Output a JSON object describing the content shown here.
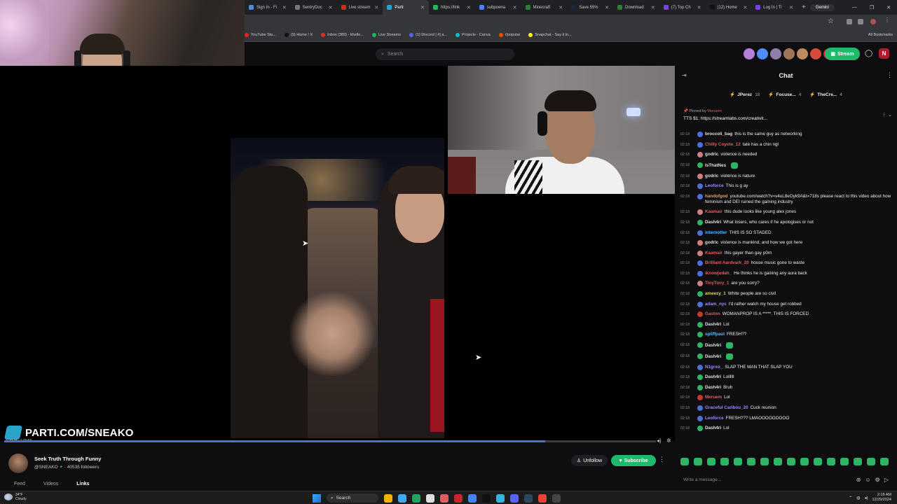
{
  "browser": {
    "tabs": [
      {
        "label": "Sign In - Fi",
        "color": "#4a90d9"
      },
      {
        "label": "SentryDoc",
        "color": "#777"
      },
      {
        "label": "Live stream",
        "color": "#e62117"
      },
      {
        "label": "Parti",
        "color": "#2aa3c9",
        "active": true
      },
      {
        "label": "https://link",
        "color": "#1db954"
      },
      {
        "label": "subpoena",
        "color": "#4285f4"
      },
      {
        "label": "Minecraft",
        "color": "#2e7d32"
      },
      {
        "label": "Save 55%",
        "color": "#1b2838"
      },
      {
        "label": "Download",
        "color": "#2e7d32"
      },
      {
        "label": "(7) Top Ch",
        "color": "#7b3fe4"
      },
      {
        "label": "(12) Home",
        "color": "#111"
      },
      {
        "label": "Log In | Ti",
        "color": "#7b3fe4"
      }
    ],
    "new_tab": "+",
    "gemini_label": "Gemini",
    "window_controls": [
      "—",
      "❐",
      "✕"
    ],
    "bookmarks": [
      {
        "label": "YouTube Stu...",
        "color": "#e62117"
      },
      {
        "label": "(9) Home / X",
        "color": "#111"
      },
      {
        "label": "Inbox (389) - khelle...",
        "color": "#d93025"
      },
      {
        "label": "Live Streams",
        "color": "#1db954"
      },
      {
        "label": "(1) Discord | #| a...",
        "color": "#5865f2"
      },
      {
        "label": "Projects - Canva",
        "color": "#00c4cc"
      },
      {
        "label": "r/popular",
        "color": "#ff4500"
      },
      {
        "label": "Snapchat - Say it in...",
        "color": "#fffc00"
      }
    ],
    "all_bookmarks": "All Bookmarks"
  },
  "site": {
    "search_placeholder": "Search",
    "stream_button": "Stream",
    "me_initial": "N",
    "avatar_colors": [
      "#b57edc",
      "#4f8ef7",
      "#8e7fa8",
      "#a0765a",
      "#c08860",
      "#d44b3b",
      "#d6213a"
    ]
  },
  "video": {
    "brand_text": "PARTI.COM/SNEAKO",
    "timestamp": "1:20:18 / 1:20:56",
    "progress_fraction": 0.83
  },
  "channel": {
    "title": "Seek Truth Through Funny",
    "handle": "@SNEAKO",
    "followers": "40535 followers",
    "unfollow": "Unfollow",
    "subscribe": "Subscribe",
    "tabs": [
      "Feed",
      "Videos",
      "Links"
    ],
    "active_tab": "Links"
  },
  "chat": {
    "title": "Chat",
    "leaders": [
      {
        "name": "JPerez",
        "count": "18"
      },
      {
        "name": "Focuse...",
        "count": "4"
      },
      {
        "name": "TheCre...",
        "count": "4"
      }
    ],
    "pinned_by": "Pinned by",
    "pinned_user": "Meruem",
    "pinned_message": "TTS $1: https://streamlabs.com/creativit...",
    "messages": [
      {
        "time": "02:18",
        "user": "broccoli_bag",
        "color": "#e0e0e0",
        "text": "this is the same guy as networking",
        "badge": "#4f6fd8"
      },
      {
        "time": "02:18",
        "user": "Chilly Coyote_12",
        "color": "#e05d5d",
        "text": "tate has a chin ngl",
        "badge": "#4f6fd8"
      },
      {
        "time": "02:18",
        "user": "godric",
        "color": "#e0e0e0",
        "text": "violence is needed",
        "badge": "#d07f7f"
      },
      {
        "time": "02:18",
        "user": "IsThatNes",
        "color": "#e0e0e0",
        "text": "",
        "emote": true,
        "badge": "#2fb463"
      },
      {
        "time": "02:18",
        "user": "godric",
        "color": "#e0e0e0",
        "text": "violence is nature",
        "badge": "#d07f7f"
      },
      {
        "time": "02:18",
        "user": "Leoforce",
        "color": "#9c8cff",
        "text": "This is g ay",
        "badge": "#4f6fd8"
      },
      {
        "time": "02:18",
        "user": "handofgod",
        "color": "#e0a060",
        "text": "youtube.com/watch?v=v4uL8eOyk9A&t=718s please react to this video about how feminism and DEI ruined the gaming industry",
        "badge": "#4f6fd8"
      },
      {
        "time": "02:18",
        "user": "Kaamair",
        "color": "#e05d5d",
        "text": "this dude looks like young alex jones",
        "badge": "#d07f7f"
      },
      {
        "time": "02:18",
        "user": "Dash4ri",
        "color": "#e0e0e0",
        "text": "What losers, who cares if he apologises or not",
        "badge": "#2fb463"
      },
      {
        "time": "02:18",
        "user": "internotter",
        "color": "#5db8ff",
        "text": "THIS IS SO STAGED",
        "badge": "#4f6fd8"
      },
      {
        "time": "02:18",
        "user": "godric",
        "color": "#e0e0e0",
        "text": "violence is mankind, and how we got here",
        "badge": "#d07f7f"
      },
      {
        "time": "02:18",
        "user": "Kaamair",
        "color": "#e05d5d",
        "text": "this gayer than gay p0rn",
        "badge": "#d07f7f"
      },
      {
        "time": "02:18",
        "user": "Brilliant Aardvark_20",
        "color": "#e05d5d",
        "text": "house music gone to waste",
        "badge": "#4f6fd8"
      },
      {
        "time": "02:18",
        "user": "iknowjudah_",
        "color": "#e05d5d",
        "text": "He thinks he is gaining any aura back",
        "badge": "#4f6fd8"
      },
      {
        "time": "02:18",
        "user": "TinyTony_1",
        "color": "#e05d5d",
        "text": "are you sorry?",
        "badge": "#d07f7f"
      },
      {
        "time": "02:18",
        "user": "ameezy_1",
        "color": "#e0d060",
        "text": "White people are so civil",
        "badge": "#2fb463"
      },
      {
        "time": "02:18",
        "user": "adam_nyc",
        "color": "#9c8cff",
        "text": "I'd rather watch my house get robbed",
        "badge": "#4f6fd8"
      },
      {
        "time": "02:18",
        "user": "Gaston",
        "color": "#e05d5d",
        "text": "WOMANPROP IS A *****. THIS IS FORCED",
        "badge": "#c0392b"
      },
      {
        "time": "02:18",
        "user": "Dash4ri",
        "color": "#e0e0e0",
        "text": "Lol",
        "badge": "#2fb463"
      },
      {
        "time": "02:18",
        "user": "spliffpaul",
        "color": "#5db8ff",
        "text": "FRESH??",
        "badge": "#2fb463"
      },
      {
        "time": "02:18",
        "user": "Dash4ri",
        "color": "#e0e0e0",
        "text": "",
        "emote": true,
        "badge": "#2fb463"
      },
      {
        "time": "02:18",
        "user": "Dash4ri",
        "color": "#e0e0e0",
        "text": "",
        "emote": true,
        "badge": "#2fb463"
      },
      {
        "time": "02:18",
        "user": "N1grxo_",
        "color": "#9c8cff",
        "text": "SLAP THE MAN THAT SLAP YOU",
        "badge": "#4f6fd8"
      },
      {
        "time": "02:18",
        "user": "Dash4ri",
        "color": "#e0e0e0",
        "text": "Lollllll",
        "badge": "#2fb463"
      },
      {
        "time": "02:18",
        "user": "Dash4ri",
        "color": "#e0e0e0",
        "text": "Bruh",
        "badge": "#2fb463"
      },
      {
        "time": "02:18",
        "user": "Meruem",
        "color": "#e05d5d",
        "text": "Lol",
        "badge": "#c0392b"
      },
      {
        "time": "02:18",
        "user": "Graceful Caribou_20",
        "color": "#9c8cff",
        "text": "Cuck reunion",
        "badge": "#4f6fd8"
      },
      {
        "time": "02:18",
        "user": "Leoforce",
        "color": "#9c8cff",
        "text": "FRESH??? LMAOOOOOOOOO",
        "badge": "#4f6fd8"
      },
      {
        "time": "02:18",
        "user": "Dash4ri",
        "color": "#e0e0e0",
        "text": "Lol",
        "badge": "#2fb463"
      }
    ],
    "input_placeholder": "Write a message...",
    "emote_count": 16
  },
  "taskbar": {
    "temp": "34°F",
    "condition": "Cloudy",
    "search": "Search",
    "time": "2:18 AM",
    "date": "12/29/2024",
    "apps": [
      "#f0b400",
      "#3fa9f5",
      "#1fa463",
      "#e0e0e0",
      "#e05d5d",
      "#c62828",
      "#4285f4",
      "#111",
      "#2fb5e0",
      "#5865f2",
      "#2a475e",
      "#ea4335",
      "#444"
    ]
  }
}
